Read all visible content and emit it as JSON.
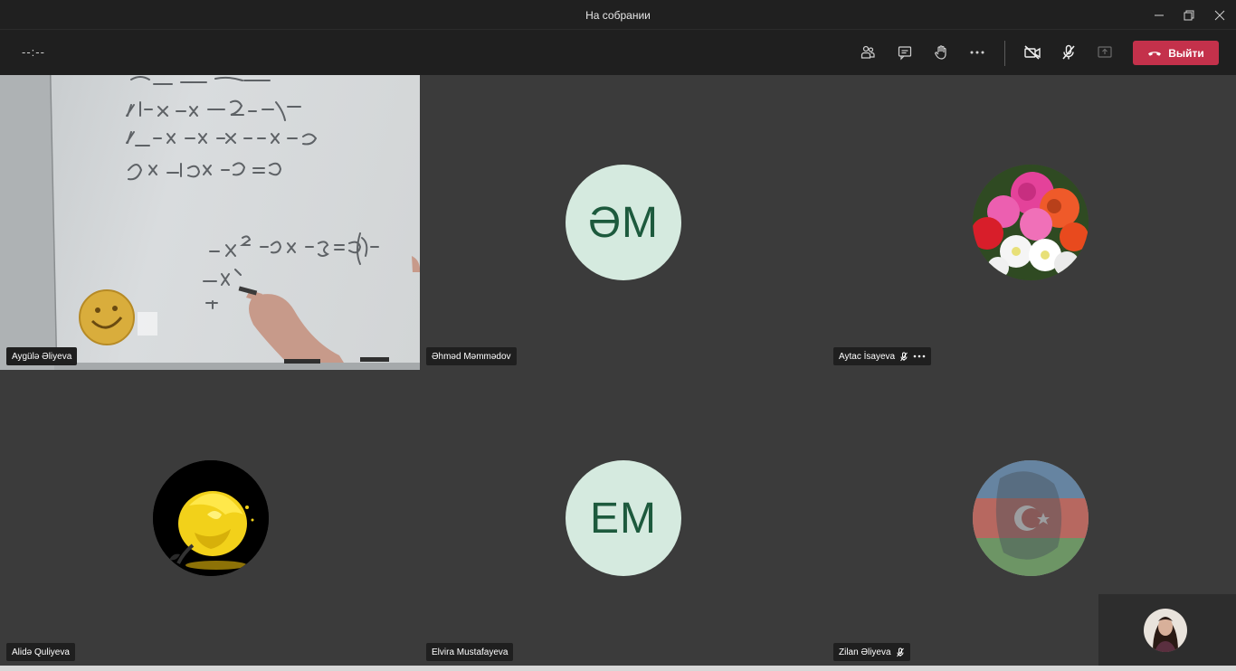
{
  "window": {
    "title": "На собрании"
  },
  "toolbar": {
    "timer": "--:--",
    "leave_label": "Выйти"
  },
  "participants": [
    {
      "name": "Aygülə Əliyeva",
      "type": "video"
    },
    {
      "name": "Əhməd Məmmədov",
      "type": "initials",
      "initials": "ƏM"
    },
    {
      "name": "Aytac İsayeva",
      "type": "photo",
      "muted": true
    },
    {
      "name": "Alidə Quliyeva",
      "type": "photo"
    },
    {
      "name": "Elvira Mustafayeva",
      "type": "initials",
      "initials": "EM"
    },
    {
      "name": "Zilan Əliyeva",
      "type": "photo",
      "muted": true
    }
  ],
  "colors": {
    "leave_button": "#c4314b",
    "tile_background": "#3b3b3b",
    "initials_background": "#d5eadf",
    "initials_text": "#1d5a3d"
  },
  "icons": [
    "people-icon",
    "chat-icon",
    "raise-hand-icon",
    "more-icon",
    "camera-off-icon",
    "mic-off-icon",
    "share-screen-icon",
    "phone-hangup-icon"
  ]
}
